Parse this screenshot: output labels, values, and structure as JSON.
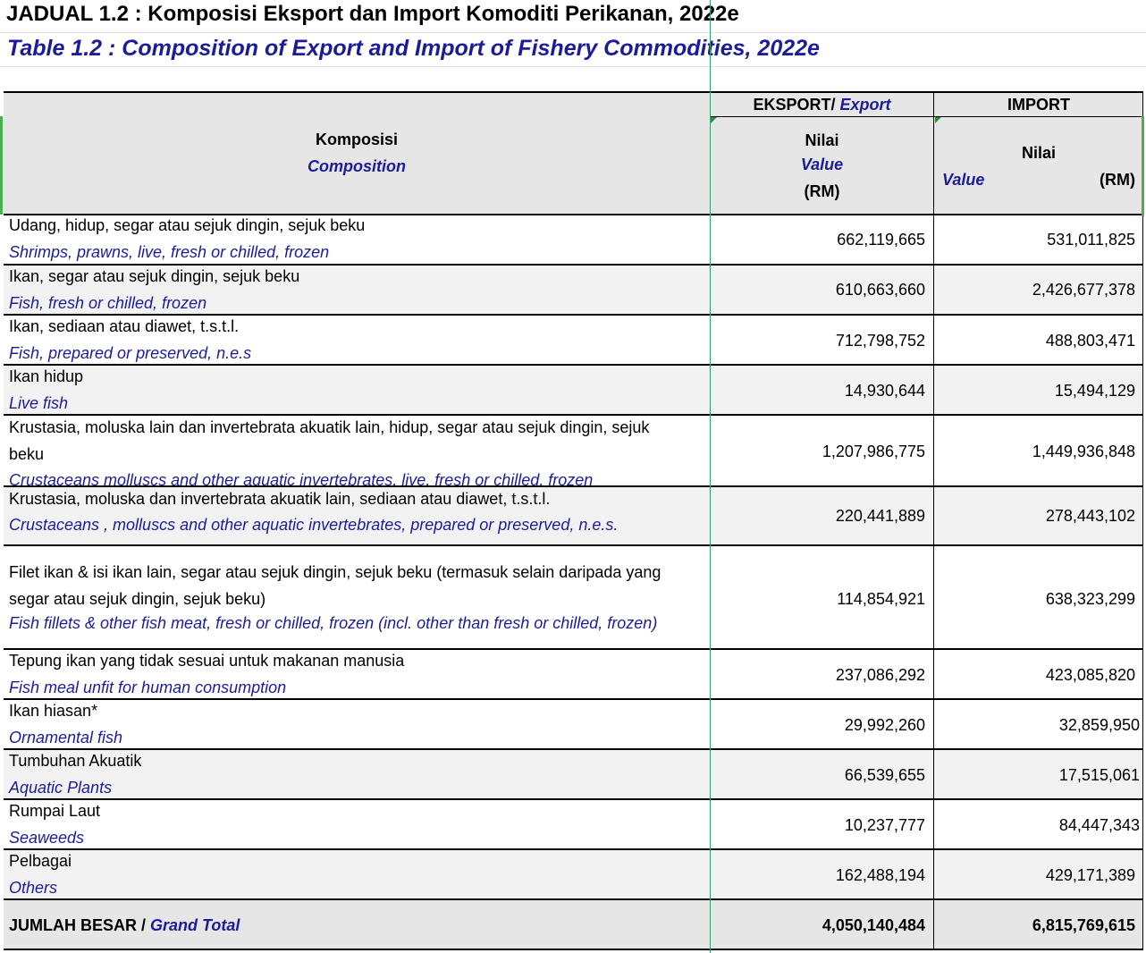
{
  "title": {
    "ms": "JADUAL 1.2 : Komposisi Eksport dan Import Komoditi Perikanan, 2022e",
    "en": "Table 1.2  : Composition of Export and Import of Fishery Commodities, 2022e"
  },
  "header": {
    "composition_ms": "Komposisi",
    "composition_en": "Composition",
    "export_ms": "EKSPORT/",
    "export_en": "Export",
    "import": "IMPORT",
    "value_ms": "Nilai",
    "value_en": "Value",
    "unit": "(RM)"
  },
  "rows": [
    {
      "ms": "Udang, hidup, segar atau sejuk dingin, sejuk beku",
      "en": "Shrimps, prawns, live, fresh or chilled, frozen",
      "export": "662,119,665",
      "import": "531,011,825"
    },
    {
      "ms": "Ikan, segar atau sejuk dingin, sejuk beku",
      "en": "Fish, fresh or chilled, frozen",
      "export": "610,663,660",
      "import": "2,426,677,378"
    },
    {
      "ms": "Ikan, sediaan atau diawet, t.s.t.l.",
      "en": "Fish, prepared or preserved, n.e.s",
      "export": "712,798,752",
      "import": "488,803,471"
    },
    {
      "ms": "Ikan hidup",
      "en": "Live fish",
      "export": "14,930,644",
      "import": "15,494,129"
    },
    {
      "ms": "Krustasia, moluska lain dan invertebrata akuatik lain, hidup, segar atau sejuk dingin, sejuk",
      "ms2": "beku",
      "en": "Crustaceans molluscs and other aquatic invertebrates, live, fresh or chilled, frozen",
      "export": "1,207,986,775",
      "import": "1,449,936,848"
    },
    {
      "ms": "Krustasia, moluska dan invertebrata akuatik lain, sediaan atau diawet, t.s.t.l.",
      "en": "Crustaceans , molluscs and other aquatic invertebrates, prepared or preserved, n.e.s.",
      "export": "220,441,889",
      "import": "278,443,102"
    },
    {
      "ms": "Filet ikan & isi ikan lain, segar atau sejuk dingin, sejuk beku (termasuk selain daripada yang",
      "ms2": "segar atau sejuk dingin, sejuk beku)",
      "en": "Fish fillets & other fish meat, fresh or chilled, frozen (incl. other than fresh or chilled, frozen)",
      "export": "114,854,921",
      "import": "638,323,299"
    },
    {
      "ms": "Tepung ikan yang tidak sesuai untuk makanan manusia",
      "en": "Fish meal unfit for human consumption",
      "export": "237,086,292",
      "import": "423,085,820"
    },
    {
      "ms": "Ikan hiasan*",
      "en": "Ornamental fish",
      "export": "29,992,260",
      "import": "32,859,950"
    },
    {
      "ms": "Tumbuhan Akuatik",
      "en": "Aquatic Plants",
      "export": "66,539,655",
      "import": "17,515,061"
    },
    {
      "ms": "Rumpai Laut",
      "en": "Seaweeds",
      "export": "10,237,777",
      "import": "84,447,343"
    },
    {
      "ms": "Pelbagai",
      "en": "Others",
      "export": "162,488,194",
      "import": "429,171,389"
    }
  ],
  "total": {
    "ms": "JUMLAH BESAR /",
    "en": "Grand Total",
    "export": "4,050,140,484",
    "import": "6,815,769,615"
  }
}
